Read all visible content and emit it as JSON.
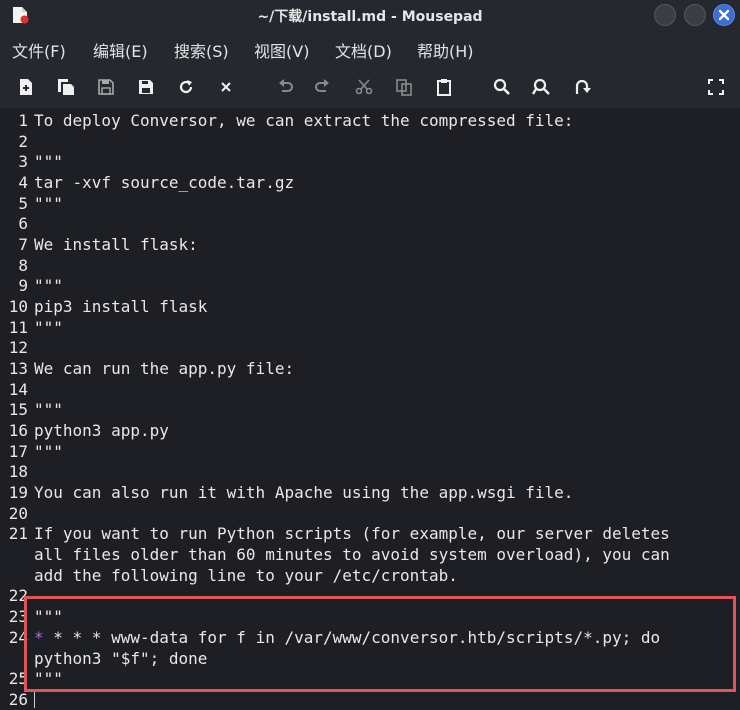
{
  "window": {
    "title": "~/下载/install.md - Mousepad",
    "icons": [
      "mousepad-app-icon",
      "minimize-icon",
      "maximize-icon",
      "close-icon"
    ]
  },
  "menu": {
    "items": [
      {
        "label": "文件(F)"
      },
      {
        "label": "编辑(E)"
      },
      {
        "label": "搜索(S)"
      },
      {
        "label": "视图(V)"
      },
      {
        "label": "文档(D)"
      },
      {
        "label": "帮助(H)"
      }
    ]
  },
  "toolbar": {
    "icons": [
      "new-document-icon",
      "new-window-icon",
      "save-icon",
      "save-as-icon",
      "reload-icon",
      "close-document-icon",
      "undo-icon",
      "redo-icon",
      "cut-icon",
      "copy-icon",
      "paste-icon",
      "find-icon",
      "find-replace-icon",
      "go-to-icon",
      "fullscreen-icon"
    ]
  },
  "editor": {
    "lines": [
      {
        "num": "1",
        "text": "To deploy Conversor, we can extract the compressed file:"
      },
      {
        "num": "2",
        "text": ""
      },
      {
        "num": "3",
        "text": "\"\"\""
      },
      {
        "num": "4",
        "text": "tar -xvf source_code.tar.gz"
      },
      {
        "num": "5",
        "text": "\"\"\""
      },
      {
        "num": "6",
        "text": ""
      },
      {
        "num": "7",
        "text": "We install flask:"
      },
      {
        "num": "8",
        "text": ""
      },
      {
        "num": "9",
        "text": "\"\"\""
      },
      {
        "num": "10",
        "text": "pip3 install flask"
      },
      {
        "num": "11",
        "text": "\"\"\""
      },
      {
        "num": "12",
        "text": ""
      },
      {
        "num": "13",
        "text": "We can run the app.py file:"
      },
      {
        "num": "14",
        "text": ""
      },
      {
        "num": "15",
        "text": "\"\"\""
      },
      {
        "num": "16",
        "text": "python3 app.py"
      },
      {
        "num": "17",
        "text": "\"\"\""
      },
      {
        "num": "18",
        "text": ""
      },
      {
        "num": "19",
        "text": "You can also run it with Apache using the app.wsgi file."
      },
      {
        "num": "20",
        "text": ""
      },
      {
        "num": "21",
        "text": "If you want to run Python scripts (for example, our server deletes"
      },
      {
        "num": "",
        "text": "all files older than 60 minutes to avoid system overload), you can"
      },
      {
        "num": "",
        "text": "add the following line to your /etc/crontab."
      },
      {
        "num": "22",
        "text": ""
      },
      {
        "num": "23",
        "text": "\"\"\""
      },
      {
        "num": "24",
        "text": "* * * * www-data for f in /var/www/conversor.htb/scripts/*.py; do",
        "first_char": "*"
      },
      {
        "num": "",
        "text": "python3 \"$f\"; done"
      },
      {
        "num": "25",
        "text": "\"\"\""
      },
      {
        "num": "26",
        "text": ""
      }
    ]
  },
  "colors": {
    "background": "#1e1f24",
    "chrome": "#262830",
    "text": "#e8e8e8",
    "highlight_border": "#e0545a",
    "accent_star": "#b070e0",
    "close_button": "#3b6fd6"
  }
}
